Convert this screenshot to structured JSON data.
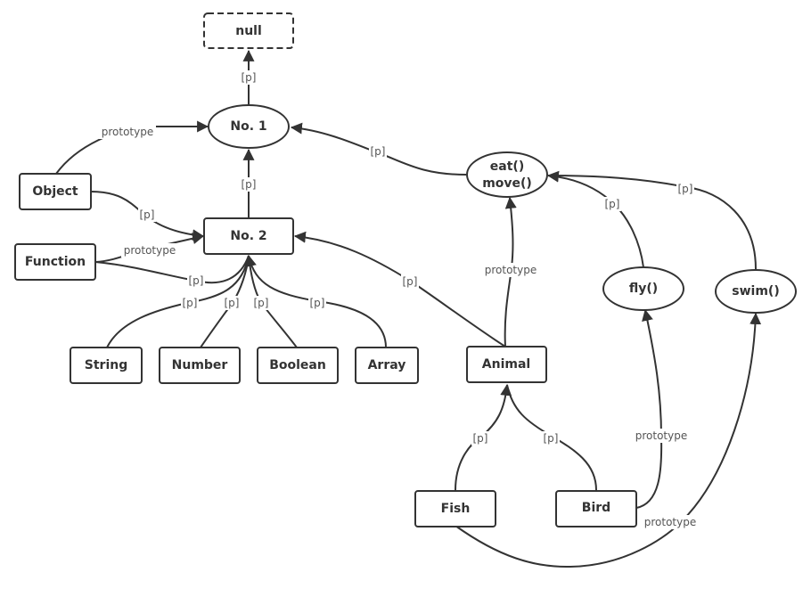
{
  "diagram": {
    "nodes": {
      "null": {
        "label": "null",
        "shape": "dashed-rect"
      },
      "no1": {
        "label": "No. 1",
        "shape": "ellipse"
      },
      "no2": {
        "label": "No. 2",
        "shape": "rect"
      },
      "object": {
        "label": "Object",
        "shape": "rect"
      },
      "function": {
        "label": "Function",
        "shape": "rect"
      },
      "string": {
        "label": "String",
        "shape": "rect"
      },
      "number": {
        "label": "Number",
        "shape": "rect"
      },
      "boolean": {
        "label": "Boolean",
        "shape": "rect"
      },
      "array": {
        "label": "Array",
        "shape": "rect"
      },
      "animal": {
        "label": "Animal",
        "shape": "rect"
      },
      "eatmove": {
        "label_line1": "eat()",
        "label_line2": "move()",
        "shape": "ellipse"
      },
      "fly": {
        "label": "fly()",
        "shape": "ellipse"
      },
      "swim": {
        "label": "swim()",
        "shape": "ellipse"
      },
      "fish": {
        "label": "Fish",
        "shape": "rect"
      },
      "bird": {
        "label": "Bird",
        "shape": "rect"
      }
    },
    "edges": [
      {
        "from": "No. 1",
        "to": "null",
        "label": "[p]"
      },
      {
        "from": "Object",
        "to": "No. 1",
        "label": "prototype"
      },
      {
        "from": "No. 2",
        "to": "No. 1",
        "label": "[p]"
      },
      {
        "from": "eat() move()",
        "to": "No. 1",
        "label": "[p]"
      },
      {
        "from": "Object",
        "to": "No. 2",
        "label": "[p]"
      },
      {
        "from": "Function",
        "to": "No. 2",
        "label": "prototype"
      },
      {
        "from": "Function",
        "to": "No. 2",
        "label": "[p]"
      },
      {
        "from": "String",
        "to": "No. 2",
        "label": "[p]"
      },
      {
        "from": "Number",
        "to": "No. 2",
        "label": "[p]"
      },
      {
        "from": "Boolean",
        "to": "No. 2",
        "label": "[p]"
      },
      {
        "from": "Array",
        "to": "No. 2",
        "label": "[p]"
      },
      {
        "from": "Animal",
        "to": "No. 2",
        "label": "[p]"
      },
      {
        "from": "Animal",
        "to": "eat() move()",
        "label": "prototype"
      },
      {
        "from": "fly()",
        "to": "eat() move()",
        "label": "[p]"
      },
      {
        "from": "swim()",
        "to": "eat() move()",
        "label": "[p]"
      },
      {
        "from": "Fish",
        "to": "Animal",
        "label": "[p]"
      },
      {
        "from": "Bird",
        "to": "Animal",
        "label": "[p]"
      },
      {
        "from": "Bird",
        "to": "fly()",
        "label": "prototype"
      },
      {
        "from": "Fish",
        "to": "swim()",
        "label": "prototype"
      }
    ],
    "colors": {
      "stroke": "#333333",
      "label": "#555555",
      "background": "#ffffff"
    }
  }
}
